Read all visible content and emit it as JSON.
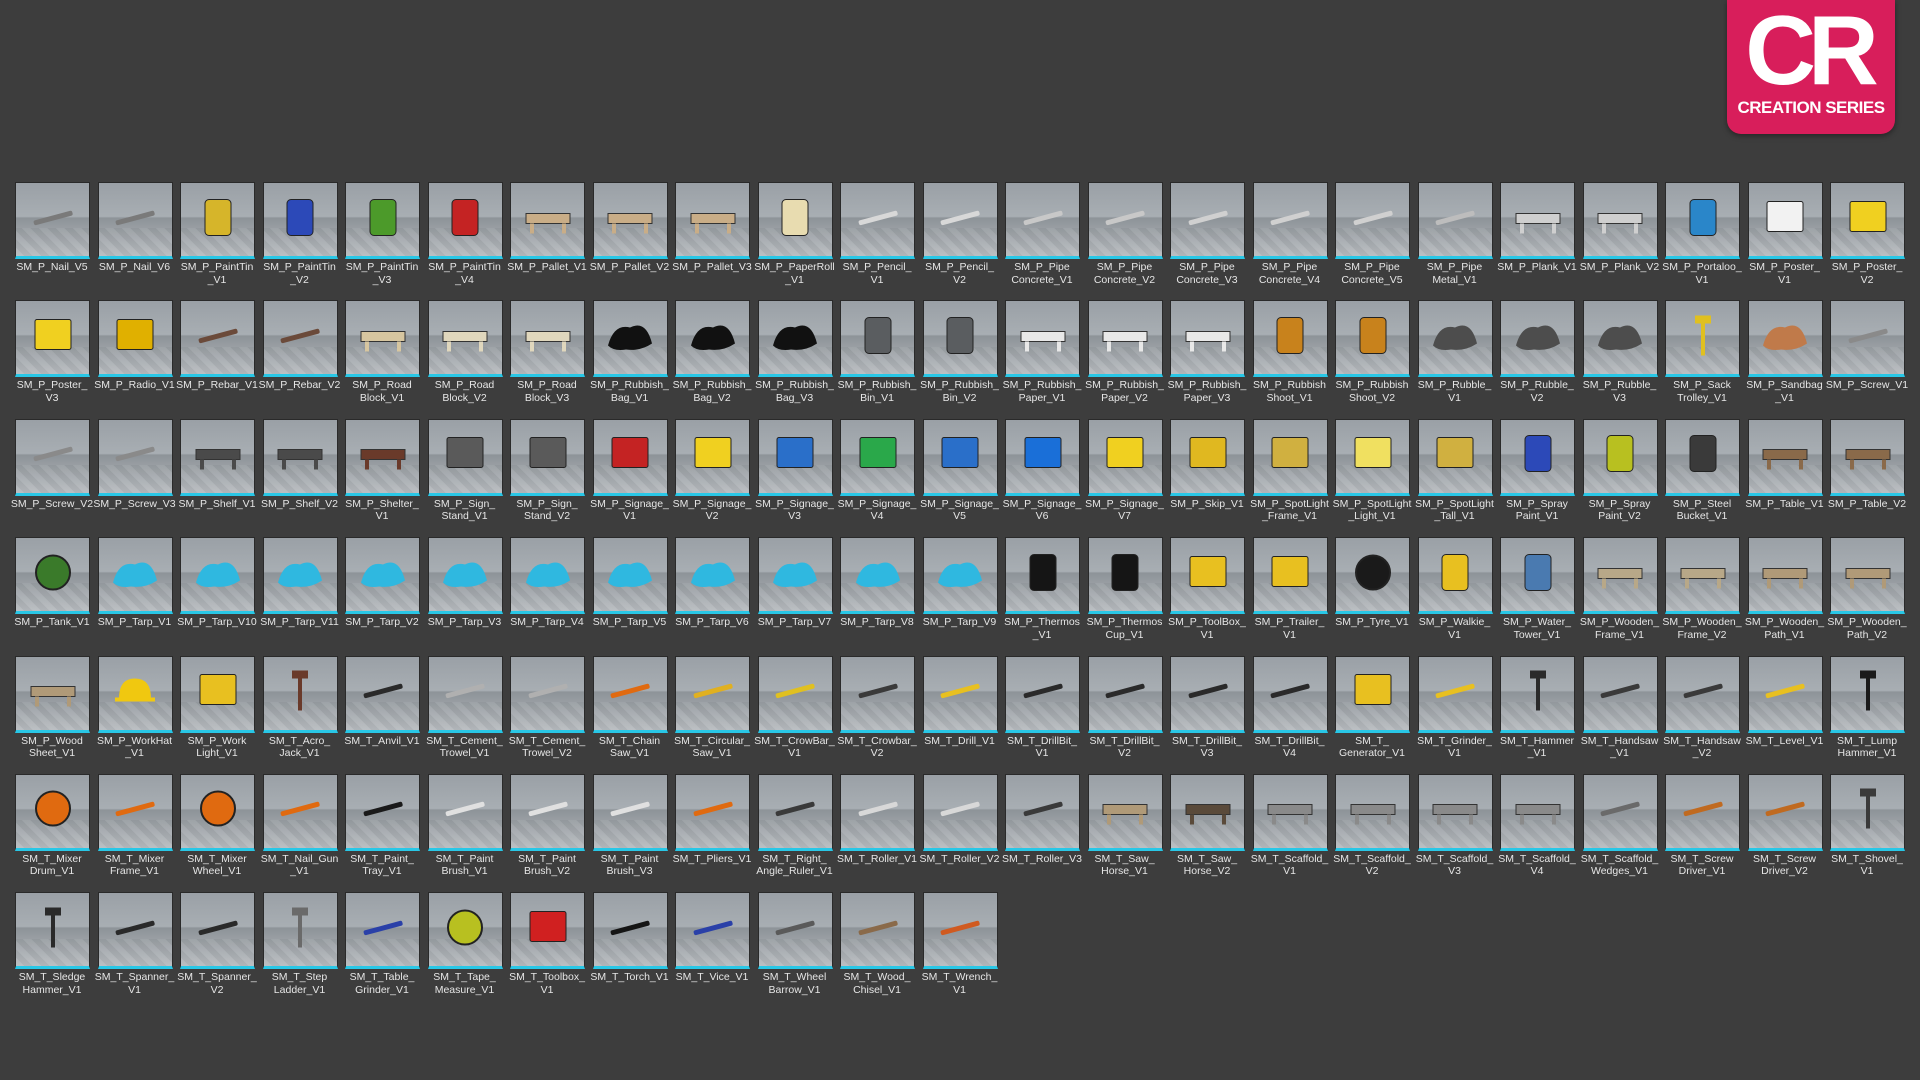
{
  "brand": {
    "mark": "CR",
    "subtitle": "CREATION SERIES",
    "color": "#d81e5b"
  },
  "accent_color": "#29c7e6",
  "assets": [
    {
      "label": "SM_P_Nail_V5",
      "color": "#7a7a7a",
      "icon": "nail-icon"
    },
    {
      "label": "SM_P_Nail_V6",
      "color": "#7a7a7a",
      "icon": "nail-icon"
    },
    {
      "label": "SM_P_PaintTin\n_V1",
      "color": "#d6b52a",
      "icon": "paint-tin-icon"
    },
    {
      "label": "SM_P_PaintTin\n_V2",
      "color": "#2c49b8",
      "icon": "paint-tin-icon"
    },
    {
      "label": "SM_P_PaintTin\n_V3",
      "color": "#4c9a2a",
      "icon": "paint-tin-icon"
    },
    {
      "label": "SM_P_PaintTin\n_V4",
      "color": "#c42323",
      "icon": "paint-tin-icon"
    },
    {
      "label": "SM_P_Pallet_V1",
      "color": "#c9ad87",
      "icon": "pallet-icon"
    },
    {
      "label": "SM_P_Pallet_V2",
      "color": "#c9ad87",
      "icon": "pallet-icon"
    },
    {
      "label": "SM_P_Pallet_V3",
      "color": "#c9ad87",
      "icon": "pallet-icon"
    },
    {
      "label": "SM_P_PaperRoll\n_V1",
      "color": "#e8dcb0",
      "icon": "paper-roll-icon"
    },
    {
      "label": "SM_P_Pencil_\nV1",
      "color": "#d8d8d8",
      "icon": "pencil-icon"
    },
    {
      "label": "SM_P_Pencil_\nV2",
      "color": "#d8d8d8",
      "icon": "pencil-icon"
    },
    {
      "label": "SM_P_Pipe\nConcrete_V1",
      "color": "#c8c8c8",
      "icon": "pipe-icon"
    },
    {
      "label": "SM_P_Pipe\nConcrete_V2",
      "color": "#c8c8c8",
      "icon": "pipe-icon"
    },
    {
      "label": "SM_P_Pipe\nConcrete_V3",
      "color": "#d0d0d0",
      "icon": "pipe-icon"
    },
    {
      "label": "SM_P_Pipe\nConcrete_V4",
      "color": "#d0d0d0",
      "icon": "pipe-icon"
    },
    {
      "label": "SM_P_Pipe\nConcrete_V5",
      "color": "#d0d0d0",
      "icon": "pipe-icon"
    },
    {
      "label": "SM_P_Pipe\nMetal_V1",
      "color": "#bdbdbd",
      "icon": "pipe-icon"
    },
    {
      "label": "SM_P_Plank_V1",
      "color": "#cfcfcf",
      "icon": "plank-icon"
    },
    {
      "label": "SM_P_Plank_V2",
      "color": "#cfcfcf",
      "icon": "plank-icon"
    },
    {
      "label": "SM_P_Portaloo_\nV1",
      "color": "#2a86c9",
      "icon": "portaloo-icon"
    },
    {
      "label": "SM_P_Poster_\nV1",
      "color": "#f2f2f2",
      "icon": "poster-icon"
    },
    {
      "label": "SM_P_Poster_\nV2",
      "color": "#f0d020",
      "icon": "poster-icon"
    },
    {
      "label": "SM_P_Poster_\nV3",
      "color": "#f0d020",
      "icon": "poster-icon"
    },
    {
      "label": "SM_P_Radio_V1",
      "color": "#e0b000",
      "icon": "radio-icon"
    },
    {
      "label": "SM_P_Rebar_V1",
      "color": "#6b4a3a",
      "icon": "rebar-icon"
    },
    {
      "label": "SM_P_Rebar_V2",
      "color": "#6b4a3a",
      "icon": "rebar-icon"
    },
    {
      "label": "SM_P_Road\nBlock_V1",
      "color": "#d7c6a0",
      "icon": "road-block-icon"
    },
    {
      "label": "SM_P_Road\nBlock_V2",
      "color": "#e0d7bd",
      "icon": "road-block-icon"
    },
    {
      "label": "SM_P_Road\nBlock_V3",
      "color": "#e0d7bd",
      "icon": "road-block-icon"
    },
    {
      "label": "SM_P_Rubbish_\nBag_V1",
      "color": "#111111",
      "icon": "rubbish-bag-icon"
    },
    {
      "label": "SM_P_Rubbish_\nBag_V2",
      "color": "#111111",
      "icon": "rubbish-bag-icon"
    },
    {
      "label": "SM_P_Rubbish_\nBag_V3",
      "color": "#111111",
      "icon": "rubbish-bag-icon"
    },
    {
      "label": "SM_P_Rubbish_\nBin_V1",
      "color": "#5a5d60",
      "icon": "rubbish-bin-icon"
    },
    {
      "label": "SM_P_Rubbish_\nBin_V2",
      "color": "#5a5d60",
      "icon": "rubbish-bin-icon"
    },
    {
      "label": "SM_P_Rubbish_\nPaper_V1",
      "color": "#e8e8e8",
      "icon": "paper-scrap-icon"
    },
    {
      "label": "SM_P_Rubbish_\nPaper_V2",
      "color": "#e8e8e8",
      "icon": "paper-scrap-icon"
    },
    {
      "label": "SM_P_Rubbish_\nPaper_V3",
      "color": "#e8e8e8",
      "icon": "paper-scrap-icon"
    },
    {
      "label": "SM_P_Rubbish\nShoot_V1",
      "color": "#c8821c",
      "icon": "rubbish-chute-icon"
    },
    {
      "label": "SM_P_Rubbish\nShoot_V2",
      "color": "#c8821c",
      "icon": "rubbish-chute-icon"
    },
    {
      "label": "SM_P_Rubble_\nV1",
      "color": "#4d4d4d",
      "icon": "rubble-icon"
    },
    {
      "label": "SM_P_Rubble_\nV2",
      "color": "#4d4d4d",
      "icon": "rubble-icon"
    },
    {
      "label": "SM_P_Rubble_\nV3",
      "color": "#4d4d4d",
      "icon": "rubble-icon"
    },
    {
      "label": "SM_P_Sack\nTrolley_V1",
      "color": "#e0c020",
      "icon": "sack-trolley-icon"
    },
    {
      "label": "SM_P_Sandbag\n_V1",
      "color": "#c07a4a",
      "icon": "sandbag-icon"
    },
    {
      "label": "SM_P_Screw_V1",
      "color": "#8a8a8a",
      "icon": "screw-icon"
    },
    {
      "label": "SM_P_Screw_V2",
      "color": "#8a8a8a",
      "icon": "screw-icon"
    },
    {
      "label": "SM_P_Screw_V3",
      "color": "#8a8a8a",
      "icon": "screw-icon"
    },
    {
      "label": "SM_P_Shelf_V1",
      "color": "#4a4a4a",
      "icon": "shelf-icon"
    },
    {
      "label": "SM_P_Shelf_V2",
      "color": "#4a4a4a",
      "icon": "shelf-icon"
    },
    {
      "label": "SM_P_Shelter_\nV1",
      "color": "#6a3a2a",
      "icon": "shelter-icon"
    },
    {
      "label": "SM_P_Sign_\nStand_V1",
      "color": "#5a5a5a",
      "icon": "sign-stand-icon"
    },
    {
      "label": "SM_P_Sign_\nStand_V2",
      "color": "#5a5a5a",
      "icon": "sign-stand-icon"
    },
    {
      "label": "SM_P_Signage_\nV1",
      "color": "#c42323",
      "icon": "sign-icon"
    },
    {
      "label": "SM_P_Signage_\nV2",
      "color": "#f0d020",
      "icon": "sign-icon"
    },
    {
      "label": "SM_P_Signage_\nV3",
      "color": "#2a6fc9",
      "icon": "sign-icon"
    },
    {
      "label": "SM_P_Signage_\nV4",
      "color": "#2aa84a",
      "icon": "sign-icon"
    },
    {
      "label": "SM_P_Signage_\nV5",
      "color": "#2a6fc9",
      "icon": "sign-icon"
    },
    {
      "label": "SM_P_Signage_\nV6",
      "color": "#1a6fd8",
      "icon": "sign-icon"
    },
    {
      "label": "SM_P_Signage_\nV7",
      "color": "#f0d020",
      "icon": "sign-icon"
    },
    {
      "label": "SM_P_Skip_V1",
      "color": "#e0b820",
      "icon": "skip-icon"
    },
    {
      "label": "SM_P_SpotLight\n_Frame_V1",
      "color": "#d0b040",
      "icon": "spotlight-icon"
    },
    {
      "label": "SM_P_SpotLight\n_Light_V1",
      "color": "#f0e060",
      "icon": "spotlight-icon"
    },
    {
      "label": "SM_P_SpotLight\n_Tall_V1",
      "color": "#d0b040",
      "icon": "spotlight-icon"
    },
    {
      "label": "SM_P_Spray\nPaint_V1",
      "color": "#2c49b8",
      "icon": "spray-can-icon"
    },
    {
      "label": "SM_P_Spray\nPaint_V2",
      "color": "#b8c020",
      "icon": "spray-can-icon"
    },
    {
      "label": "SM_P_Steel\nBucket_V1",
      "color": "#3a3a3a",
      "icon": "bucket-icon"
    },
    {
      "label": "SM_P_Table_V1",
      "color": "#8a6a4a",
      "icon": "table-icon"
    },
    {
      "label": "SM_P_Table_V2",
      "color": "#8a6a4a",
      "icon": "table-icon"
    },
    {
      "label": "SM_P_Tank_V1",
      "color": "#3a7a2a",
      "icon": "tank-icon"
    },
    {
      "label": "SM_P_Tarp_V1",
      "color": "#2fb8e0",
      "icon": "tarp-icon"
    },
    {
      "label": "SM_P_Tarp_V10",
      "color": "#2fb8e0",
      "icon": "tarp-icon"
    },
    {
      "label": "SM_P_Tarp_V11",
      "color": "#2fb8e0",
      "icon": "tarp-icon"
    },
    {
      "label": "SM_P_Tarp_V2",
      "color": "#2fb8e0",
      "icon": "tarp-icon"
    },
    {
      "label": "SM_P_Tarp_V3",
      "color": "#2fb8e0",
      "icon": "tarp-icon"
    },
    {
      "label": "SM_P_Tarp_V4",
      "color": "#2fb8e0",
      "icon": "tarp-icon"
    },
    {
      "label": "SM_P_Tarp_V5",
      "color": "#2fb8e0",
      "icon": "tarp-icon"
    },
    {
      "label": "SM_P_Tarp_V6",
      "color": "#2fb8e0",
      "icon": "tarp-icon"
    },
    {
      "label": "SM_P_Tarp_V7",
      "color": "#2fb8e0",
      "icon": "tarp-icon"
    },
    {
      "label": "SM_P_Tarp_V8",
      "color": "#2fb8e0",
      "icon": "tarp-icon"
    },
    {
      "label": "SM_P_Tarp_V9",
      "color": "#2fb8e0",
      "icon": "tarp-icon"
    },
    {
      "label": "SM_P_Thermos\n_V1",
      "color": "#151515",
      "icon": "thermos-icon"
    },
    {
      "label": "SM_P_Thermos\nCup_V1",
      "color": "#151515",
      "icon": "cup-icon"
    },
    {
      "label": "SM_P_ToolBox_\nV1",
      "color": "#e8c020",
      "icon": "toolbox-icon"
    },
    {
      "label": "SM_P_Trailer_\nV1",
      "color": "#e8c020",
      "icon": "trailer-icon"
    },
    {
      "label": "SM_P_Tyre_V1",
      "color": "#1a1a1a",
      "icon": "tyre-icon"
    },
    {
      "label": "SM_P_Walkie_\nV1",
      "color": "#e8c020",
      "icon": "walkie-talkie-icon"
    },
    {
      "label": "SM_P_Water_\nTower_V1",
      "color": "#4a7ab0",
      "icon": "water-tower-icon"
    },
    {
      "label": "SM_P_Wooden_\nFrame_V1",
      "color": "#b8a888",
      "icon": "wood-frame-icon"
    },
    {
      "label": "SM_P_Wooden_\nFrame_V2",
      "color": "#b8a888",
      "icon": "wood-frame-icon"
    },
    {
      "label": "SM_P_Wooden_\nPath_V1",
      "color": "#b09a78",
      "icon": "wood-path-icon"
    },
    {
      "label": "SM_P_Wooden_\nPath_V2",
      "color": "#b09a78",
      "icon": "wood-path-icon"
    },
    {
      "label": "SM_P_Wood\nSheet_V1",
      "color": "#b09a78",
      "icon": "wood-sheet-icon"
    },
    {
      "label": "SM_P_WorkHat\n_V1",
      "color": "#f0c810",
      "icon": "hard-hat-icon"
    },
    {
      "label": "SM_P_Work\nLight_V1",
      "color": "#e8c020",
      "icon": "work-light-icon"
    },
    {
      "label": "SM_T_Acro_\nJack_V1",
      "color": "#6a3a2a",
      "icon": "acro-jack-icon"
    },
    {
      "label": "SM_T_Anvil_V1",
      "color": "#2a2a2a",
      "icon": "anvil-icon"
    },
    {
      "label": "SM_T_Cement_\nTrowel_V1",
      "color": "#b0b0b0",
      "icon": "trowel-icon"
    },
    {
      "label": "SM_T_Cement_\nTrowel_V2",
      "color": "#b0b0b0",
      "icon": "trowel-icon"
    },
    {
      "label": "SM_T_Chain\nSaw_V1",
      "color": "#e06a10",
      "icon": "chainsaw-icon"
    },
    {
      "label": "SM_T_Circular_\nSaw_V1",
      "color": "#e0b020",
      "icon": "circular-saw-icon"
    },
    {
      "label": "SM_T_CrowBar_\nV1",
      "color": "#e0c020",
      "icon": "crowbar-icon"
    },
    {
      "label": "SM_T_Crowbar_\nV2",
      "color": "#3a3a3a",
      "icon": "crowbar-icon"
    },
    {
      "label": "SM_T_Drill_V1",
      "color": "#e8c020",
      "icon": "drill-icon"
    },
    {
      "label": "SM_T_DrillBit_\nV1",
      "color": "#2a2a2a",
      "icon": "drill-bit-icon"
    },
    {
      "label": "SM_T_DrillBit_\nV2",
      "color": "#2a2a2a",
      "icon": "drill-bit-icon"
    },
    {
      "label": "SM_T_DrillBit_\nV3",
      "color": "#2a2a2a",
      "icon": "drill-bit-icon"
    },
    {
      "label": "SM_T_DrillBit_\nV4",
      "color": "#2a2a2a",
      "icon": "drill-bit-icon"
    },
    {
      "label": "SM_T_\nGenerator_V1",
      "color": "#e8c020",
      "icon": "generator-icon"
    },
    {
      "label": "SM_T_Grinder_\nV1",
      "color": "#e8c020",
      "icon": "grinder-icon"
    },
    {
      "label": "SM_T_Hammer\n_V1",
      "color": "#2a2a2a",
      "icon": "hammer-icon"
    },
    {
      "label": "SM_T_Handsaw\n_V1",
      "color": "#3a3a3a",
      "icon": "handsaw-icon"
    },
    {
      "label": "SM_T_Handsaw\n_V2",
      "color": "#3a3a3a",
      "icon": "handsaw-icon"
    },
    {
      "label": "SM_T_Level_V1",
      "color": "#e8c020",
      "icon": "level-icon"
    },
    {
      "label": "SM_T_Lump\nHammer_V1",
      "color": "#1a1a1a",
      "icon": "lump-hammer-icon"
    },
    {
      "label": "SM_T_Mixer\nDrum_V1",
      "color": "#e06a10",
      "icon": "mixer-drum-icon"
    },
    {
      "label": "SM_T_Mixer\nFrame_V1",
      "color": "#e06a10",
      "icon": "mixer-frame-icon"
    },
    {
      "label": "SM_T_Mixer\nWheel_V1",
      "color": "#e06a10",
      "icon": "mixer-wheel-icon"
    },
    {
      "label": "SM_T_Nail_Gun\n_V1",
      "color": "#e06a10",
      "icon": "nail-gun-icon"
    },
    {
      "label": "SM_T_Paint_\nTray_V1",
      "color": "#1a1a1a",
      "icon": "paint-tray-icon"
    },
    {
      "label": "SM_T_Paint\nBrush_V1",
      "color": "#e0e0e0",
      "icon": "paint-brush-icon"
    },
    {
      "label": "SM_T_Paint\nBrush_V2",
      "color": "#e0e0e0",
      "icon": "paint-brush-icon"
    },
    {
      "label": "SM_T_Paint\nBrush_V3",
      "color": "#e0e0e0",
      "icon": "paint-brush-icon"
    },
    {
      "label": "SM_T_Pliers_V1",
      "color": "#e06a10",
      "icon": "pliers-icon"
    },
    {
      "label": "SM_T_Right_\nAngle_Ruler_V1",
      "color": "#3a3a3a",
      "icon": "ruler-icon"
    },
    {
      "label": "SM_T_Roller_V1",
      "color": "#d8d8d8",
      "icon": "roller-icon"
    },
    {
      "label": "SM_T_Roller_V2",
      "color": "#d8d8d8",
      "icon": "roller-icon"
    },
    {
      "label": "SM_T_Roller_V3",
      "color": "#3a3a3a",
      "icon": "roller-icon"
    },
    {
      "label": "SM_T_Saw_\nHorse_V1",
      "color": "#b09a78",
      "icon": "saw-horse-icon"
    },
    {
      "label": "SM_T_Saw_\nHorse_V2",
      "color": "#5a4a3a",
      "icon": "saw-horse-icon"
    },
    {
      "label": "SM_T_Scaffold_\nV1",
      "color": "#8a8a8a",
      "icon": "scaffold-icon"
    },
    {
      "label": "SM_T_Scaffold_\nV2",
      "color": "#8a8a8a",
      "icon": "scaffold-icon"
    },
    {
      "label": "SM_T_Scaffold_\nV3",
      "color": "#8a8a8a",
      "icon": "scaffold-icon"
    },
    {
      "label": "SM_T_Scaffold_\nV4",
      "color": "#8a8a8a",
      "icon": "scaffold-icon"
    },
    {
      "label": "SM_T_Scaffold_\nWedges_V1",
      "color": "#6a6a6a",
      "icon": "wedge-icon"
    },
    {
      "label": "SM_T_Screw\nDriver_V1",
      "color": "#c06a20",
      "icon": "screwdriver-icon"
    },
    {
      "label": "SM_T_Screw\nDriver_V2",
      "color": "#c06a20",
      "icon": "screwdriver-icon"
    },
    {
      "label": "SM_T_Shovel_\nV1",
      "color": "#3a3a3a",
      "icon": "shovel-icon"
    },
    {
      "label": "SM_T_Sledge\nHammer_V1",
      "color": "#2a2a2a",
      "icon": "sledge-hammer-icon"
    },
    {
      "label": "SM_T_Spanner_\nV1",
      "color": "#2a2a2a",
      "icon": "spanner-icon"
    },
    {
      "label": "SM_T_Spanner_\nV2",
      "color": "#2a2a2a",
      "icon": "spanner-icon"
    },
    {
      "label": "SM_T_Step\nLadder_V1",
      "color": "#6a6a6a",
      "icon": "ladder-icon"
    },
    {
      "label": "SM_T_Table_\nGrinder_V1",
      "color": "#2a40a8",
      "icon": "bench-grinder-icon"
    },
    {
      "label": "SM_T_Tape_\nMeasure_V1",
      "color": "#b8c020",
      "icon": "tape-measure-icon"
    },
    {
      "label": "SM_T_Toolbox_\nV1",
      "color": "#d02020",
      "icon": "toolbox-icon"
    },
    {
      "label": "SM_T_Torch_V1",
      "color": "#151515",
      "icon": "torch-icon"
    },
    {
      "label": "SM_T_Vice_V1",
      "color": "#2a40a8",
      "icon": "vice-icon"
    },
    {
      "label": "SM_T_Wheel\nBarrow_V1",
      "color": "#5a5a5a",
      "icon": "wheelbarrow-icon"
    },
    {
      "label": "SM_T_Wood_\nChisel_V1",
      "color": "#8a6a4a",
      "icon": "chisel-icon"
    },
    {
      "label": "SM_T_Wrench_\nV1",
      "color": "#d05a20",
      "icon": "wrench-icon"
    }
  ]
}
